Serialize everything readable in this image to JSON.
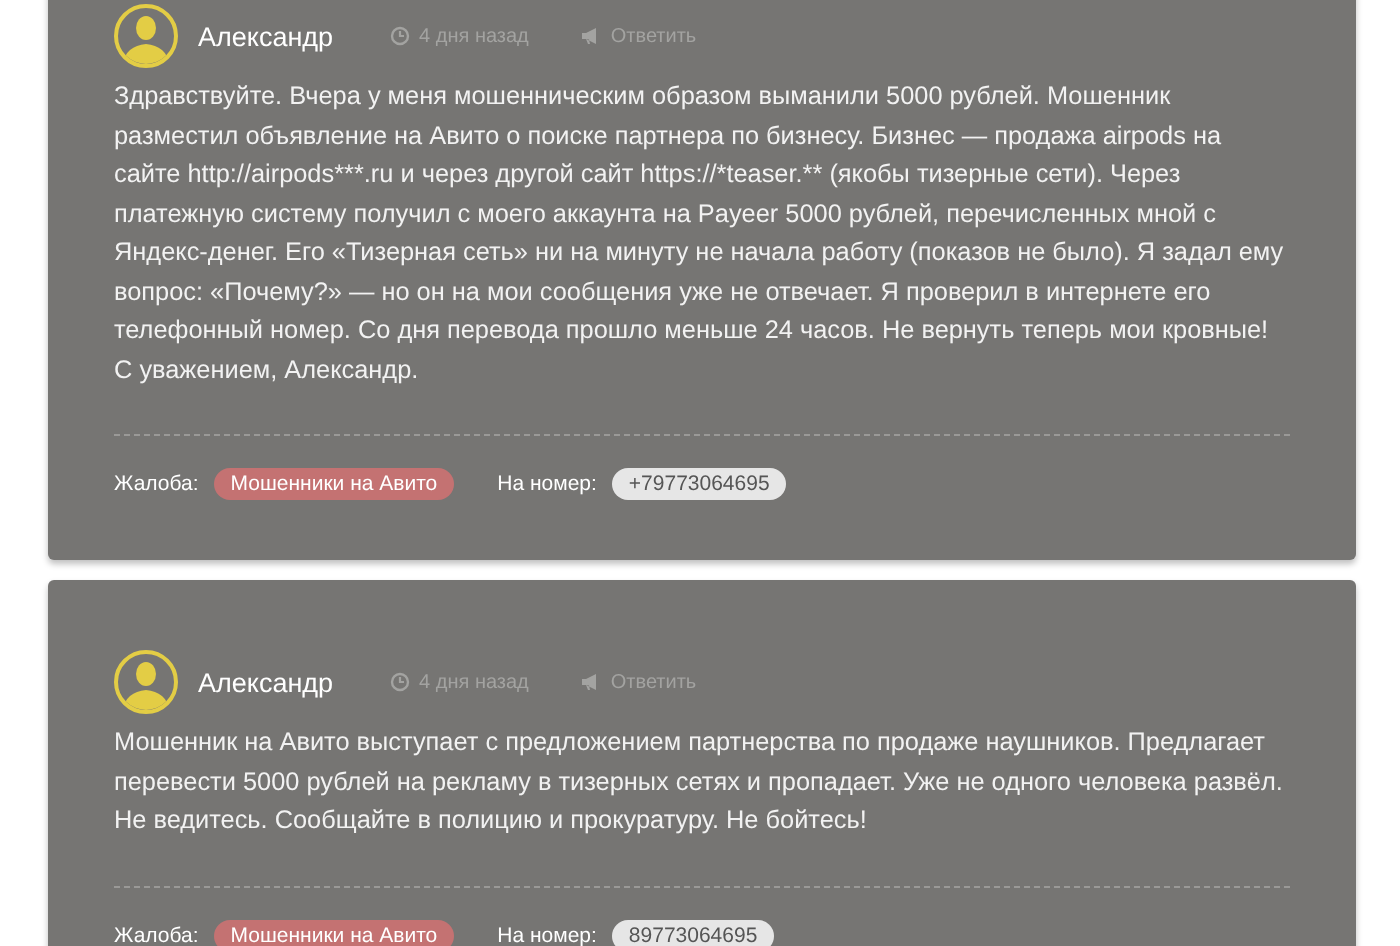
{
  "comments": [
    {
      "author": "Александр",
      "time": "4 дня назад",
      "reply": "Ответить",
      "text": "Здравствуйте. Вчера у меня мошенническим образом выманили 5000 рублей. Мошенник разместил объявление на Авито о поиске партнера по бизнесу. Бизнес — продажа airpods на сайте http://airpods***.ru и через другой сайт https://*teaser.** (якобы тизерные сети). Через платежную систему получил с моего аккаунта на Payeer 5000 рублей, перечисленных мной с Яндекс-денег. Его «Тизерная сеть» ни на минуту не начала работу (показов не было). Я задал ему вопрос: «Почему?» — но он на мои сообщения уже не отвечает. Я проверил в интернете его телефонный номер. Со дня перевода прошло меньше 24 часов. Не вернуть теперь мои кровные! С уважением, Александр.",
      "complaint_label": "Жалоба:",
      "complaint": "Мошенники на Авито",
      "number_label": "На номер:",
      "number": "+79773064695"
    },
    {
      "author": "Александр",
      "time": "4 дня назад",
      "reply": "Ответить",
      "text": "Мошенник на Авито выступает с предложением партнерства по продаже наушников. Предлагает перевести 5000 рублей на рекламу в тизерных сетях и пропадает. Уже не одного человека развёл. Не ведитесь. Сообщайте в полицию и прокуратуру. Не бойтесь!",
      "complaint_label": "Жалоба:",
      "complaint": "Мошенники на Авито",
      "number_label": "На номер:",
      "number": "89773064695"
    }
  ]
}
